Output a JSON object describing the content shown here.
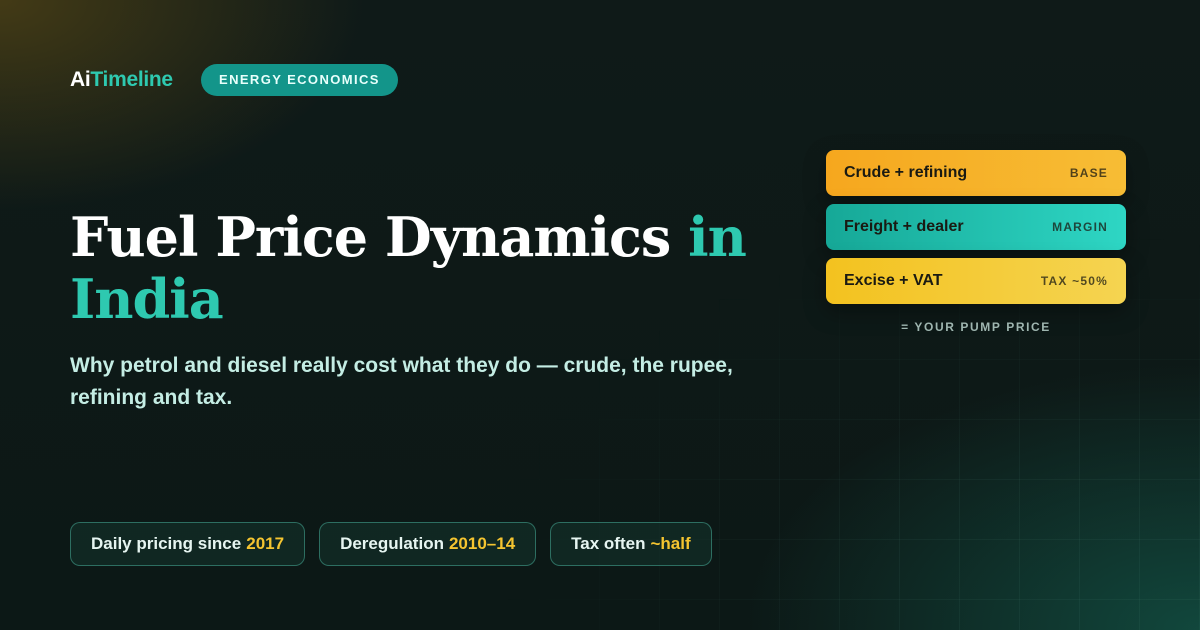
{
  "brand": {
    "prefix": "Ai",
    "suffix": "Timeline"
  },
  "tag": "ENERGY ECONOMICS",
  "title": {
    "main": "Fuel Price Dynamics",
    "accent_inline": "in",
    "accent_line2": "India"
  },
  "subtitle": "Why petrol and diesel really cost what they do — crude, the rupee, refining and tax.",
  "price_stack": {
    "layers": [
      {
        "label": "Crude + refining",
        "tag": "BASE",
        "color": "#f6a71e"
      },
      {
        "label": "Freight + dealer",
        "tag": "MARGIN",
        "color": "#16a897"
      },
      {
        "label": "Excise + VAT",
        "tag": "TAX ~50%",
        "color": "#f3c21f"
      }
    ],
    "caption": "= YOUR PUMP PRICE"
  },
  "pills": [
    {
      "text": "Daily pricing since",
      "highlight": "2017"
    },
    {
      "text": "Deregulation",
      "highlight": "2010–14"
    },
    {
      "text": "Tax often",
      "highlight": "~half"
    }
  ],
  "colors": {
    "accent": "#2ec9b0",
    "highlight": "#f4c430",
    "tag_bg": "#13958a"
  }
}
